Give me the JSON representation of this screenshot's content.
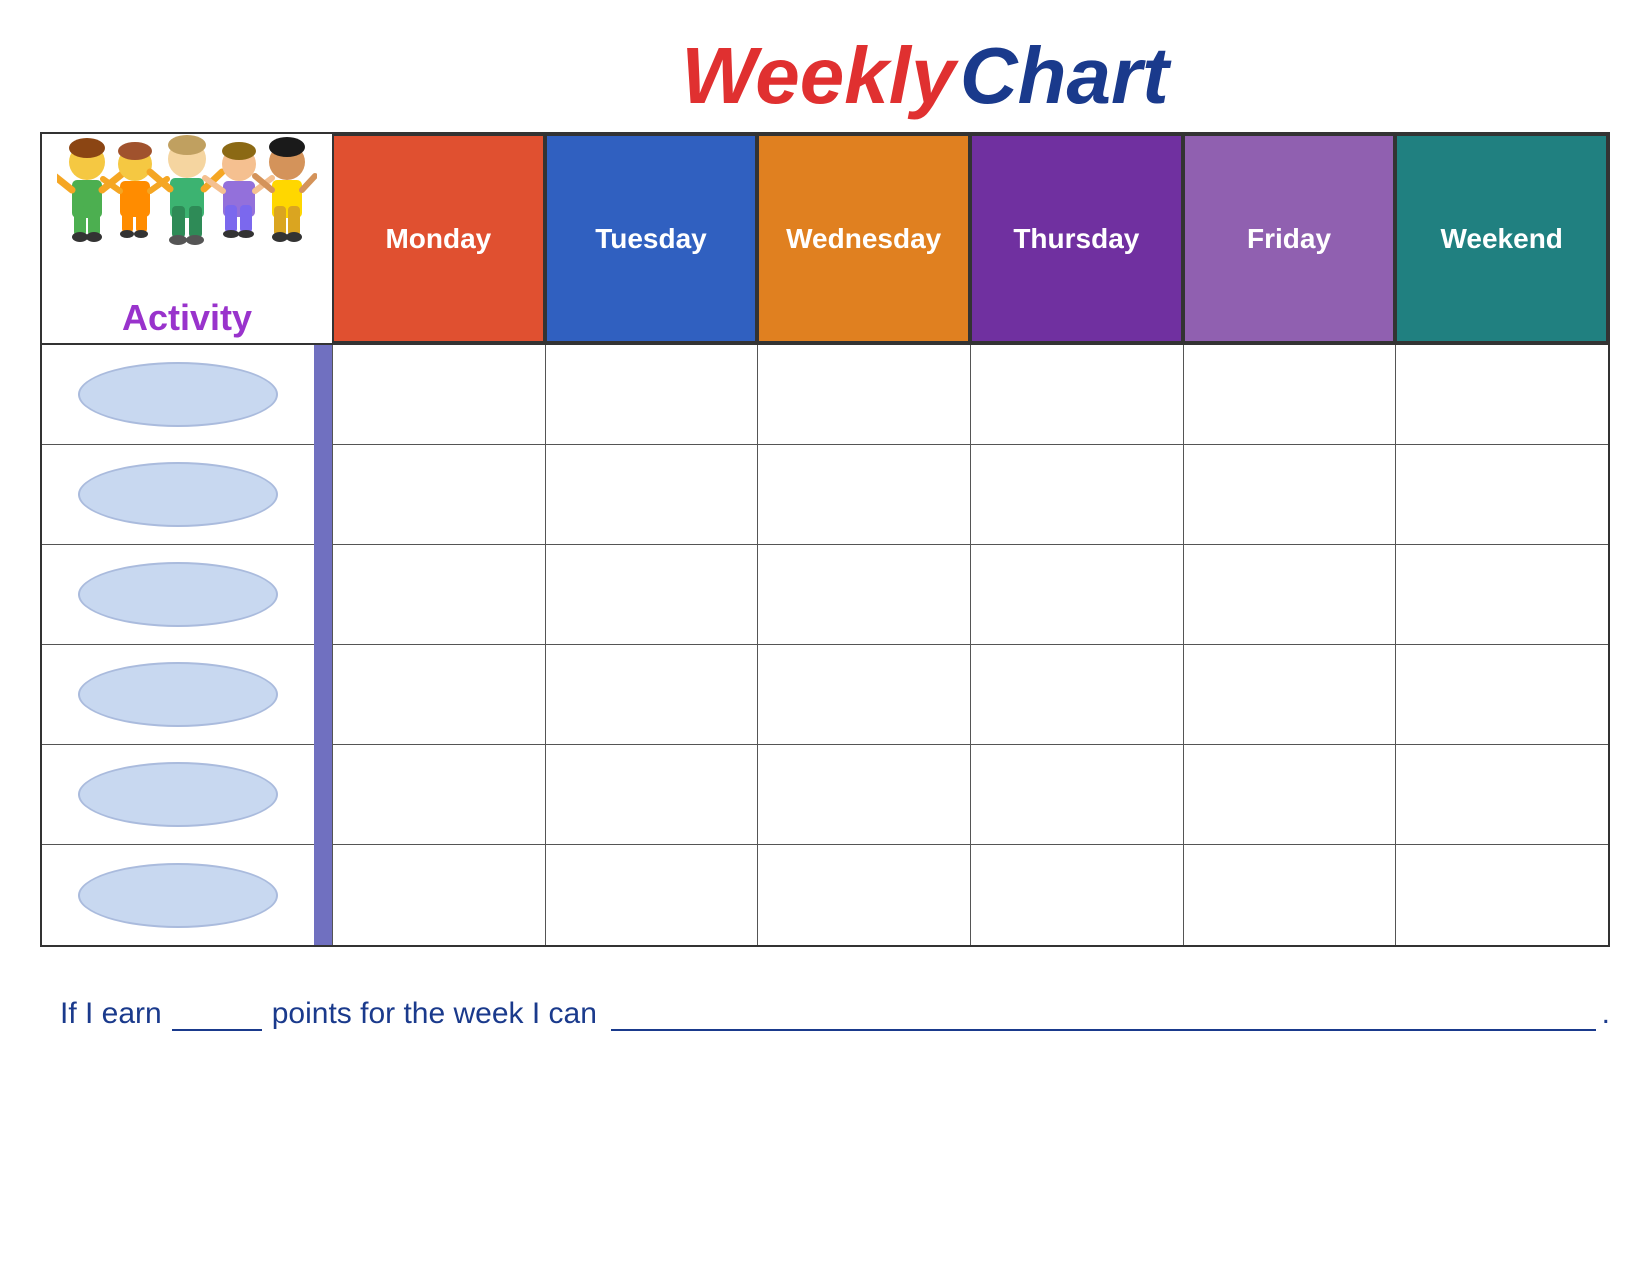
{
  "title": {
    "weekly": "Weekly",
    "chart": "Chart"
  },
  "activity_label": "Activity",
  "days": [
    {
      "id": "monday",
      "label": "Monday",
      "color": "#e05030",
      "class": "day-monday"
    },
    {
      "id": "tuesday",
      "label": "Tuesday",
      "color": "#3060c0",
      "class": "day-tuesday"
    },
    {
      "id": "wednesday",
      "label": "Wednesday",
      "color": "#e08020",
      "class": "day-wednesday"
    },
    {
      "id": "thursday",
      "label": "Thursday",
      "color": "#7030a0",
      "class": "day-thursday"
    },
    {
      "id": "friday",
      "label": "Friday",
      "color": "#9060b0",
      "class": "day-friday"
    },
    {
      "id": "weekend",
      "label": "Weekend",
      "color": "#208080",
      "class": "day-weekend"
    }
  ],
  "rows": [
    0,
    1,
    2,
    3,
    4,
    5
  ],
  "footer": {
    "text_before": "If I earn",
    "text_middle": "points for the week I can",
    "text_end": "."
  }
}
